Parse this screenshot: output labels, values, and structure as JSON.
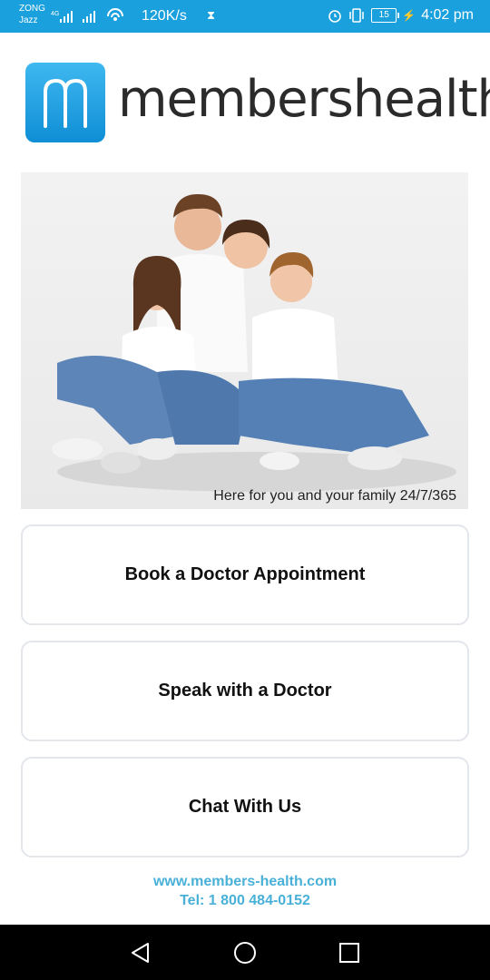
{
  "status_bar": {
    "carrier_line1": "ZONG",
    "carrier_line2": "Jazz",
    "net_type": "4G",
    "speed": "120K/s",
    "battery": "15",
    "time": "4:02 pm",
    "icons": [
      "signal-icon",
      "wifi-hotspot-icon",
      "hourglass-icon",
      "alarm-icon",
      "vibrate-icon",
      "battery-icon",
      "charging-icon"
    ]
  },
  "logo": {
    "letter": "m",
    "text": "membershealth",
    "brand_color": "#1aa0dd"
  },
  "hero": {
    "caption": "Here for you and your family 24/7/365"
  },
  "actions": {
    "book": "Book a Doctor Appointment",
    "speak": "Speak with a Doctor",
    "chat": "Chat With Us"
  },
  "footer": {
    "website": "www.members-health.com",
    "phone": "Tel: 1 800 484-0152",
    "link_color": "#49b1d8"
  },
  "nav": {
    "icons": [
      "back-icon",
      "home-icon",
      "recent-apps-icon"
    ]
  }
}
